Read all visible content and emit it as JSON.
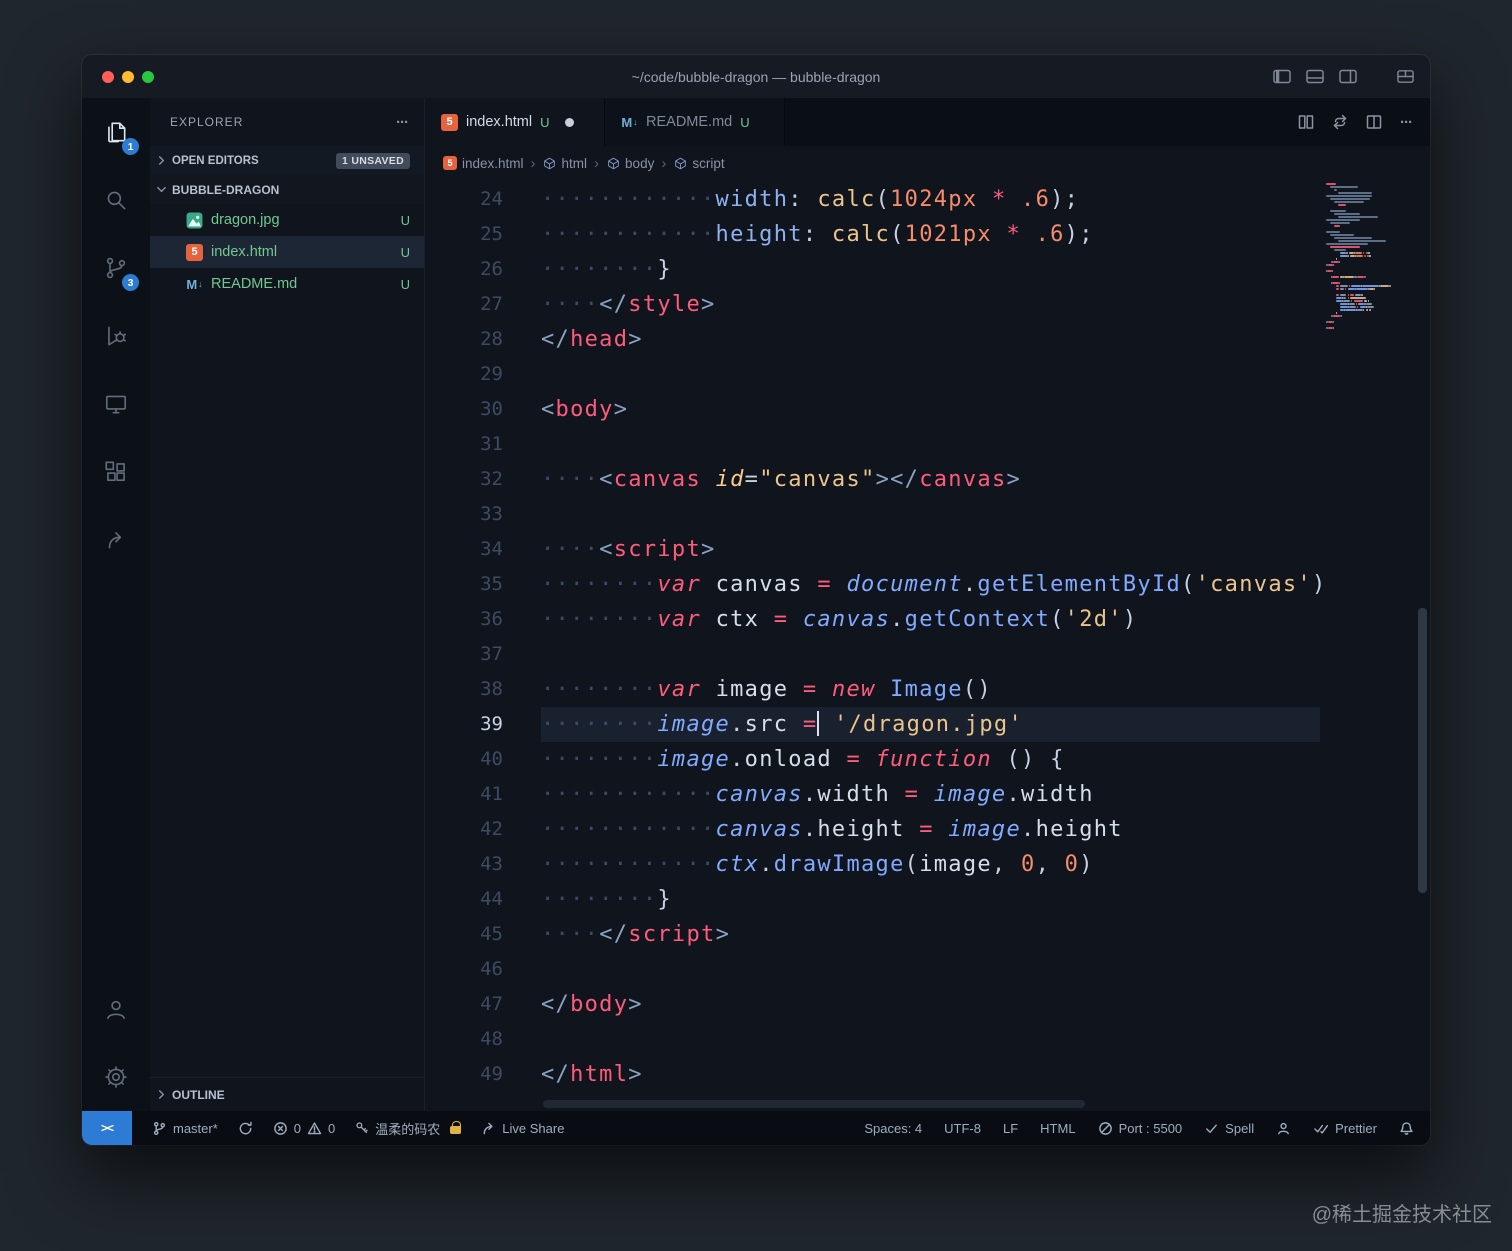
{
  "window": {
    "title": "~/code/bubble-dragon — bubble-dragon"
  },
  "activity_bar": {
    "explorer_badge": "1",
    "scm_badge": "3"
  },
  "sidebar": {
    "title": "EXPLORER",
    "open_editors_label": "OPEN EDITORS",
    "unsaved_badge": "1 UNSAVED",
    "folder": "BUBBLE-DRAGON",
    "files": [
      {
        "name": "dragon.jpg",
        "git": "U",
        "icon": "image-icon",
        "selected": false
      },
      {
        "name": "index.html",
        "git": "U",
        "icon": "html-icon",
        "selected": true
      },
      {
        "name": "README.md",
        "git": "U",
        "icon": "markdown-icon",
        "selected": false
      }
    ],
    "outline_label": "OUTLINE"
  },
  "tabs": [
    {
      "label": "index.html",
      "git": "U",
      "icon": "html-icon",
      "active": true,
      "dirty": true
    },
    {
      "label": "README.md",
      "git": "U",
      "icon": "markdown-icon",
      "active": false,
      "dirty": false
    }
  ],
  "breadcrumb": [
    {
      "label": "index.html",
      "icon": "html-icon"
    },
    {
      "label": "html",
      "icon": "symbol-icon"
    },
    {
      "label": "body",
      "icon": "symbol-icon"
    },
    {
      "label": "script",
      "icon": "symbol-icon"
    }
  ],
  "editor": {
    "cursor_line": 39,
    "lines": [
      {
        "n": 24,
        "indent": 12,
        "tokens": [
          [
            "cssprop",
            "width"
          ],
          [
            "punct",
            ":"
          ],
          [
            "plain",
            " "
          ],
          [
            "cssfn",
            "calc"
          ],
          [
            "punct",
            "("
          ],
          [
            "num",
            "1024px"
          ],
          [
            "plain",
            " "
          ],
          [
            "op",
            "*"
          ],
          [
            "plain",
            " "
          ],
          [
            "num",
            ".6"
          ],
          [
            "punct",
            ")"
          ],
          [
            "punct",
            ";"
          ]
        ]
      },
      {
        "n": 25,
        "indent": 12,
        "tokens": [
          [
            "cssprop",
            "height"
          ],
          [
            "punct",
            ":"
          ],
          [
            "plain",
            " "
          ],
          [
            "cssfn",
            "calc"
          ],
          [
            "punct",
            "("
          ],
          [
            "num",
            "1021px"
          ],
          [
            "plain",
            " "
          ],
          [
            "op",
            "*"
          ],
          [
            "plain",
            " "
          ],
          [
            "num",
            ".6"
          ],
          [
            "punct",
            ")"
          ],
          [
            "punct",
            ";"
          ]
        ]
      },
      {
        "n": 26,
        "indent": 8,
        "tokens": [
          [
            "punct",
            "}"
          ]
        ]
      },
      {
        "n": 27,
        "indent": 4,
        "tokens": [
          [
            "br",
            "</"
          ],
          [
            "tag",
            "style"
          ],
          [
            "br",
            ">"
          ]
        ]
      },
      {
        "n": 28,
        "indent": 0,
        "tokens": [
          [
            "br",
            "</"
          ],
          [
            "tag",
            "head"
          ],
          [
            "br",
            ">"
          ]
        ]
      },
      {
        "n": 29,
        "indent": 0,
        "tokens": []
      },
      {
        "n": 30,
        "indent": 0,
        "tokens": [
          [
            "br",
            "<"
          ],
          [
            "tag",
            "body"
          ],
          [
            "br",
            ">"
          ]
        ]
      },
      {
        "n": 31,
        "indent": 0,
        "tokens": []
      },
      {
        "n": 32,
        "indent": 4,
        "tokens": [
          [
            "br",
            "<"
          ],
          [
            "tag",
            "canvas"
          ],
          [
            "plain",
            " "
          ],
          [
            "attr",
            "id"
          ],
          [
            "punct",
            "="
          ],
          [
            "str",
            "\"canvas\""
          ],
          [
            "br",
            "></"
          ],
          [
            "tag",
            "canvas"
          ],
          [
            "br",
            ">"
          ]
        ]
      },
      {
        "n": 33,
        "indent": 0,
        "tokens": []
      },
      {
        "n": 34,
        "indent": 4,
        "tokens": [
          [
            "br",
            "<"
          ],
          [
            "tag",
            "script"
          ],
          [
            "br",
            ">"
          ]
        ]
      },
      {
        "n": 35,
        "indent": 8,
        "tokens": [
          [
            "kw",
            "var"
          ],
          [
            "plain",
            " "
          ],
          [
            "plain",
            "canvas"
          ],
          [
            "plain",
            " "
          ],
          [
            "op",
            "="
          ],
          [
            "plain",
            " "
          ],
          [
            "obj",
            "document"
          ],
          [
            "punct",
            "."
          ],
          [
            "fn",
            "getElementById"
          ],
          [
            "punct",
            "("
          ],
          [
            "str",
            "'canvas'"
          ],
          [
            "punct",
            ")"
          ]
        ]
      },
      {
        "n": 36,
        "indent": 8,
        "tokens": [
          [
            "kw",
            "var"
          ],
          [
            "plain",
            " "
          ],
          [
            "plain",
            "ctx"
          ],
          [
            "plain",
            " "
          ],
          [
            "op",
            "="
          ],
          [
            "plain",
            " "
          ],
          [
            "obj",
            "canvas"
          ],
          [
            "punct",
            "."
          ],
          [
            "fn",
            "getContext"
          ],
          [
            "punct",
            "("
          ],
          [
            "str",
            "'2d'"
          ],
          [
            "punct",
            ")"
          ]
        ]
      },
      {
        "n": 37,
        "indent": 0,
        "tokens": []
      },
      {
        "n": 38,
        "indent": 8,
        "tokens": [
          [
            "kw",
            "var"
          ],
          [
            "plain",
            " "
          ],
          [
            "plain",
            "image"
          ],
          [
            "plain",
            " "
          ],
          [
            "op",
            "="
          ],
          [
            "plain",
            " "
          ],
          [
            "kw",
            "new"
          ],
          [
            "plain",
            " "
          ],
          [
            "fn",
            "Image"
          ],
          [
            "punct",
            "()"
          ]
        ]
      },
      {
        "n": 39,
        "indent": 8,
        "tokens": [
          [
            "obj",
            "image"
          ],
          [
            "punct",
            "."
          ],
          [
            "plain",
            "src"
          ],
          [
            "plain",
            " "
          ],
          [
            "op",
            "="
          ],
          [
            "cursor",
            ""
          ],
          [
            "plain",
            " "
          ],
          [
            "str",
            "'/dragon.jpg'"
          ]
        ]
      },
      {
        "n": 40,
        "indent": 8,
        "tokens": [
          [
            "obj",
            "image"
          ],
          [
            "punct",
            "."
          ],
          [
            "plain",
            "onload"
          ],
          [
            "plain",
            " "
          ],
          [
            "op",
            "="
          ],
          [
            "plain",
            " "
          ],
          [
            "kw",
            "function"
          ],
          [
            "plain",
            " "
          ],
          [
            "punct",
            "()"
          ],
          [
            "plain",
            " "
          ],
          [
            "punct",
            "{"
          ]
        ]
      },
      {
        "n": 41,
        "indent": 12,
        "tokens": [
          [
            "obj",
            "canvas"
          ],
          [
            "punct",
            "."
          ],
          [
            "plain",
            "width"
          ],
          [
            "plain",
            " "
          ],
          [
            "op",
            "="
          ],
          [
            "plain",
            " "
          ],
          [
            "obj",
            "image"
          ],
          [
            "punct",
            "."
          ],
          [
            "plain",
            "width"
          ]
        ]
      },
      {
        "n": 42,
        "indent": 12,
        "tokens": [
          [
            "obj",
            "canvas"
          ],
          [
            "punct",
            "."
          ],
          [
            "plain",
            "height"
          ],
          [
            "plain",
            " "
          ],
          [
            "op",
            "="
          ],
          [
            "plain",
            " "
          ],
          [
            "obj",
            "image"
          ],
          [
            "punct",
            "."
          ],
          [
            "plain",
            "height"
          ]
        ]
      },
      {
        "n": 43,
        "indent": 12,
        "tokens": [
          [
            "obj",
            "ctx"
          ],
          [
            "punct",
            "."
          ],
          [
            "fn",
            "drawImage"
          ],
          [
            "punct",
            "("
          ],
          [
            "plain",
            "image"
          ],
          [
            "punct",
            ","
          ],
          [
            "plain",
            " "
          ],
          [
            "num",
            "0"
          ],
          [
            "punct",
            ","
          ],
          [
            "plain",
            " "
          ],
          [
            "num",
            "0"
          ],
          [
            "punct",
            ")"
          ]
        ]
      },
      {
        "n": 44,
        "indent": 8,
        "tokens": [
          [
            "punct",
            "}"
          ]
        ]
      },
      {
        "n": 45,
        "indent": 4,
        "tokens": [
          [
            "br",
            "</"
          ],
          [
            "tag",
            "script"
          ],
          [
            "br",
            ">"
          ]
        ]
      },
      {
        "n": 46,
        "indent": 0,
        "tokens": []
      },
      {
        "n": 47,
        "indent": 0,
        "tokens": [
          [
            "br",
            "</"
          ],
          [
            "tag",
            "body"
          ],
          [
            "br",
            ">"
          ]
        ]
      },
      {
        "n": 48,
        "indent": 0,
        "tokens": []
      },
      {
        "n": 49,
        "indent": 0,
        "tokens": [
          [
            "br",
            "</"
          ],
          [
            "tag",
            "html"
          ],
          [
            "br",
            ">"
          ]
        ]
      }
    ]
  },
  "status_bar": {
    "branch": "master*",
    "errors": "0",
    "warnings": "0",
    "user": "温柔的码农",
    "live_share": "Live Share",
    "spaces": "Spaces: 4",
    "encoding": "UTF-8",
    "eol": "LF",
    "language": "HTML",
    "port": "Port : 5500",
    "spell": "Spell",
    "prettier": "Prettier"
  },
  "watermark": "@稀土掘金技术社区",
  "colors": {
    "accent_blue": "#2a7dd2",
    "remote_blue": "#2e7bd6",
    "untracked_green": "#73c991",
    "lock_gold": "#e3b341",
    "editor_bg": "#0f141d",
    "keyword_red": "#ff5c7c",
    "function_blue": "#82aaff",
    "string_yellow": "#ecc48d",
    "number_orange": "#f78c6c"
  }
}
